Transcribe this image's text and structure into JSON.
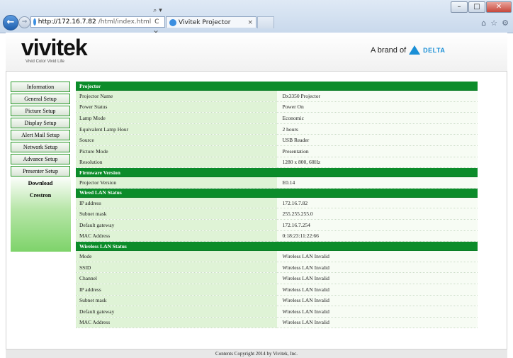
{
  "browser": {
    "url_host": "http://172.16.7.82",
    "url_path": "/html/index.html",
    "address_tools": "⌕ ▾  C ✕",
    "tab_title": "Vivitek Projector",
    "tab_close": "×",
    "window_buttons": [
      "–",
      "□",
      "✕"
    ],
    "toolbar_icons": [
      "⌂",
      "☆",
      "⚙"
    ]
  },
  "header": {
    "logo": "vivitek",
    "logo_tagline": "Vivid Color Vivid Life",
    "brand_prefix": "A brand of",
    "brand_name": "DELTA"
  },
  "sidebar": {
    "items": [
      {
        "label": "Information"
      },
      {
        "label": "General Setup"
      },
      {
        "label": "Picture Setup"
      },
      {
        "label": "Display Setup"
      },
      {
        "label": "Alert Mail Setup"
      },
      {
        "label": "Network Setup"
      },
      {
        "label": "Advance Setup"
      },
      {
        "label": "Presenter Setup"
      },
      {
        "label": "Download"
      },
      {
        "label": "Crestron"
      }
    ]
  },
  "projector": {
    "title": "Projector",
    "rows": [
      {
        "k": "Projector Name",
        "v": "Dx3350 Projector"
      },
      {
        "k": "Power Status",
        "v": "Power On"
      },
      {
        "k": "Lamp Mode",
        "v": "Economic"
      },
      {
        "k": "Equivalent Lamp Hour",
        "v": "2 hours"
      },
      {
        "k": "Source",
        "v": "USB Reader"
      },
      {
        "k": "Picture Mode",
        "v": "Presentation"
      },
      {
        "k": "Resolution",
        "v": "1280 x 800, 60Hz"
      }
    ]
  },
  "firmware": {
    "title": "Firmware Version",
    "rows": [
      {
        "k": "Projector Version",
        "v": "E0.14"
      }
    ]
  },
  "wired": {
    "title": "Wired LAN Status",
    "rows": [
      {
        "k": "IP address",
        "v": "172.16.7.82"
      },
      {
        "k": "Subnet mask",
        "v": "255.255.255.0"
      },
      {
        "k": "Default gateway",
        "v": "172.16.7.254"
      },
      {
        "k": "MAC Address",
        "v": "0:18:23:11:22:66"
      }
    ]
  },
  "wireless": {
    "title": "Wireless LAN Status",
    "rows": [
      {
        "k": "Mode",
        "v": "Wireless LAN Invalid"
      },
      {
        "k": "SSID",
        "v": "Wireless LAN Invalid"
      },
      {
        "k": "Channel",
        "v": "Wireless LAN Invalid"
      },
      {
        "k": "IP address",
        "v": "Wireless LAN Invalid"
      },
      {
        "k": "Subnet mask",
        "v": "Wireless LAN Invalid"
      },
      {
        "k": "Default gateway",
        "v": "Wireless LAN Invalid"
      },
      {
        "k": "MAC Address",
        "v": "Wireless LAN Invalid"
      }
    ]
  },
  "footer": {
    "copyright": "Contents Copyright 2014 by Vivitek, Inc."
  },
  "colors": {
    "section_header": "#0c8c2a",
    "key_cell": "#dff3d6",
    "delta_blue": "#1a8fd6"
  }
}
